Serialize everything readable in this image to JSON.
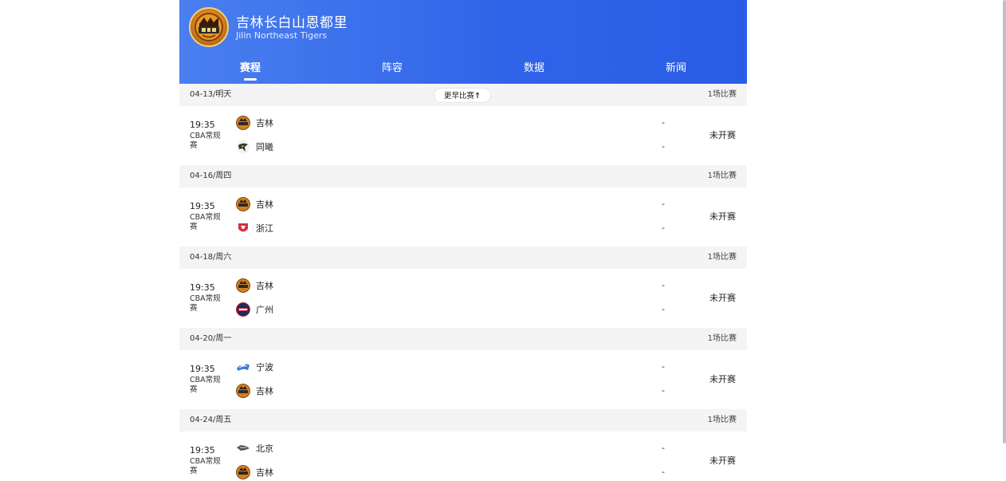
{
  "header": {
    "team_name": "吉林长白山恩都里",
    "team_name_en": "Jilin Northeast Tigers",
    "logo_icon": "tiger-logo-icon"
  },
  "tabs": [
    {
      "label": "赛程",
      "active": true
    },
    {
      "label": "阵容",
      "active": false
    },
    {
      "label": "数据",
      "active": false
    },
    {
      "label": "新闻",
      "active": false
    }
  ],
  "earlier_button": {
    "label": "更早比赛",
    "arrow": "↑"
  },
  "days": [
    {
      "date": "04-13/明天",
      "count": "1场比赛",
      "match": {
        "time": "19:35",
        "league": "CBA常规赛",
        "home": {
          "name": "吉林",
          "icon": "jilin-logo-icon"
        },
        "away": {
          "name": "同曦",
          "icon": "tongxi-logo-icon"
        },
        "home_score": "-",
        "away_score": "-",
        "status": "未开赛"
      }
    },
    {
      "date": "04-16/周四",
      "count": "1场比赛",
      "match": {
        "time": "19:35",
        "league": "CBA常规赛",
        "home": {
          "name": "吉林",
          "icon": "jilin-logo-icon"
        },
        "away": {
          "name": "浙江",
          "icon": "zhejiang-logo-icon"
        },
        "home_score": "-",
        "away_score": "-",
        "status": "未开赛"
      }
    },
    {
      "date": "04-18/周六",
      "count": "1场比赛",
      "match": {
        "time": "19:35",
        "league": "CBA常规赛",
        "home": {
          "name": "吉林",
          "icon": "jilin-logo-icon"
        },
        "away": {
          "name": "广州",
          "icon": "guangzhou-logo-icon"
        },
        "home_score": "-",
        "away_score": "-",
        "status": "未开赛"
      }
    },
    {
      "date": "04-20/周一",
      "count": "1场比赛",
      "match": {
        "time": "19:35",
        "league": "CBA常规赛",
        "home": {
          "name": "宁波",
          "icon": "ningbo-logo-icon"
        },
        "away": {
          "name": "吉林",
          "icon": "jilin-logo-icon"
        },
        "home_score": "-",
        "away_score": "-",
        "status": "未开赛"
      }
    },
    {
      "date": "04-24/周五",
      "count": "1场比赛",
      "match": {
        "time": "19:35",
        "league": "CBA常规赛",
        "home": {
          "name": "北京",
          "icon": "beijing-logo-icon"
        },
        "away": {
          "name": "吉林",
          "icon": "jilin-logo-icon"
        },
        "home_score": "-",
        "away_score": "-",
        "status": "未开赛"
      }
    }
  ],
  "colors": {
    "header_blue": "#2f63e8",
    "day_header_bg": "#f4f4f4",
    "logo_orange": "#d2821c"
  }
}
